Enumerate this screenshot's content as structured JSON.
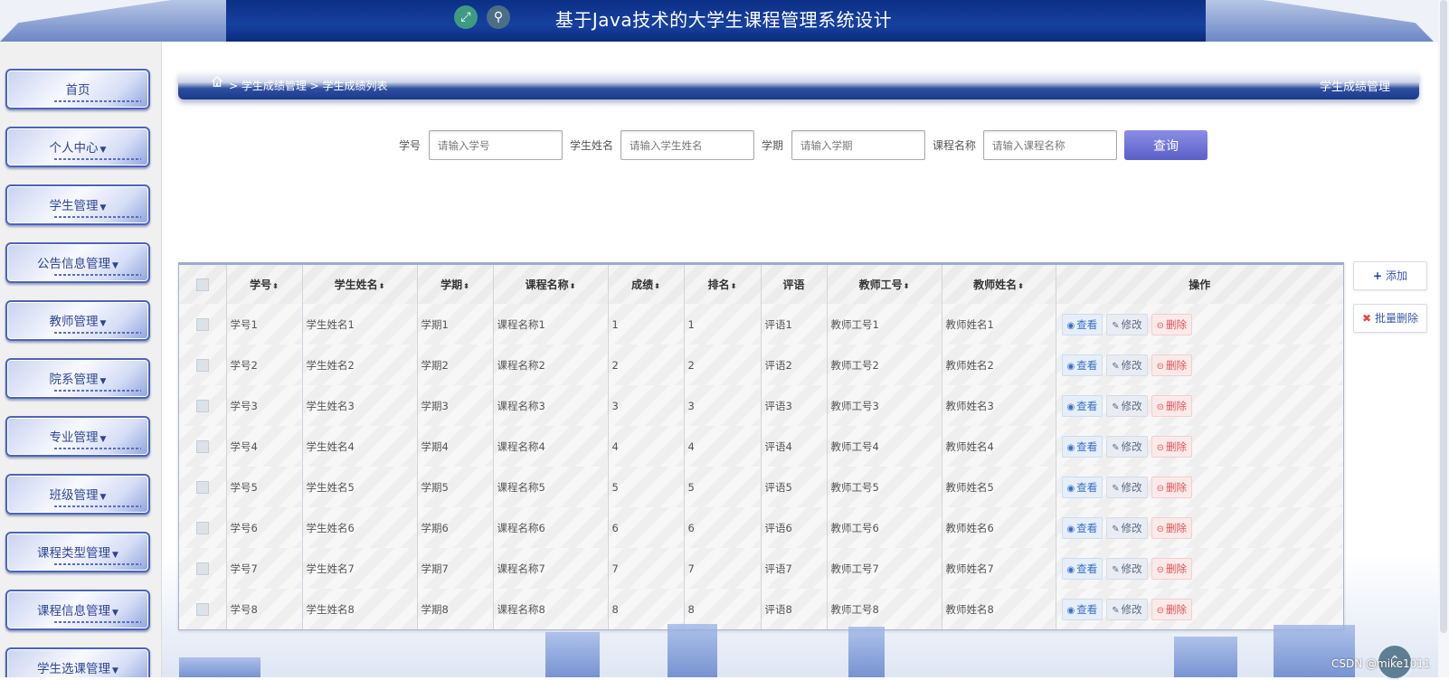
{
  "header": {
    "title": "基于Java技术的大学生课程管理系统设计",
    "expand_icon": "expand-icon",
    "user_icon": "user-icon"
  },
  "sidebar": {
    "items": [
      {
        "label": "首页",
        "has_caret": false
      },
      {
        "label": "个人中心",
        "has_caret": true
      },
      {
        "label": "学生管理",
        "has_caret": true
      },
      {
        "label": "公告信息管理",
        "has_caret": true
      },
      {
        "label": "教师管理",
        "has_caret": true
      },
      {
        "label": "院系管理",
        "has_caret": true
      },
      {
        "label": "专业管理",
        "has_caret": true
      },
      {
        "label": "班级管理",
        "has_caret": true
      },
      {
        "label": "课程类型管理",
        "has_caret": true
      },
      {
        "label": "课程信息管理",
        "has_caret": true
      },
      {
        "label": "学生选课管理",
        "has_caret": true
      }
    ]
  },
  "breadcrumb": {
    "path": "> 学生成绩管理 > 学生成绩列表",
    "right_title": "学生成绩管理"
  },
  "search": {
    "fields": [
      {
        "label": "学号",
        "placeholder": "请输入学号"
      },
      {
        "label": "学生姓名",
        "placeholder": "请输入学生姓名"
      },
      {
        "label": "学期",
        "placeholder": "请输入学期"
      },
      {
        "label": "课程名称",
        "placeholder": "请输入课程名称"
      }
    ],
    "button_label": "查询"
  },
  "actions": {
    "add_label": "添加",
    "batch_delete_label": "批量删除"
  },
  "table": {
    "columns": [
      "学号",
      "学生姓名",
      "学期",
      "课程名称",
      "成绩",
      "排名",
      "评语",
      "教师工号",
      "教师姓名",
      "操作"
    ],
    "sortable": [
      true,
      true,
      true,
      true,
      true,
      true,
      false,
      true,
      true,
      false
    ],
    "row_actions": {
      "view": "查看",
      "edit": "修改",
      "delete": "删除"
    },
    "rows": [
      [
        "学号1",
        "学生姓名1",
        "学期1",
        "课程名称1",
        "1",
        "1",
        "评语1",
        "教师工号1",
        "教师姓名1"
      ],
      [
        "学号2",
        "学生姓名2",
        "学期2",
        "课程名称2",
        "2",
        "2",
        "评语2",
        "教师工号2",
        "教师姓名2"
      ],
      [
        "学号3",
        "学生姓名3",
        "学期3",
        "课程名称3",
        "3",
        "3",
        "评语3",
        "教师工号3",
        "教师姓名3"
      ],
      [
        "学号4",
        "学生姓名4",
        "学期4",
        "课程名称4",
        "4",
        "4",
        "评语4",
        "教师工号4",
        "教师姓名4"
      ],
      [
        "学号5",
        "学生姓名5",
        "学期5",
        "课程名称5",
        "5",
        "5",
        "评语5",
        "教师工号5",
        "教师姓名5"
      ],
      [
        "学号6",
        "学生姓名6",
        "学期6",
        "课程名称6",
        "6",
        "6",
        "评语6",
        "教师工号6",
        "教师姓名6"
      ],
      [
        "学号7",
        "学生姓名7",
        "学期7",
        "课程名称7",
        "7",
        "7",
        "评语7",
        "教师工号7",
        "教师姓名7"
      ],
      [
        "学号8",
        "学生姓名8",
        "学期8",
        "课程名称8",
        "8",
        "8",
        "评语8",
        "教师工号8",
        "教师姓名8"
      ]
    ]
  },
  "watermark": "CSDN @mike1011",
  "colors": {
    "header_blue": "#0c2f86",
    "accent_purple": "#5b5fc7",
    "view_blue": "#3a6fc4",
    "delete_red": "#e05252"
  }
}
